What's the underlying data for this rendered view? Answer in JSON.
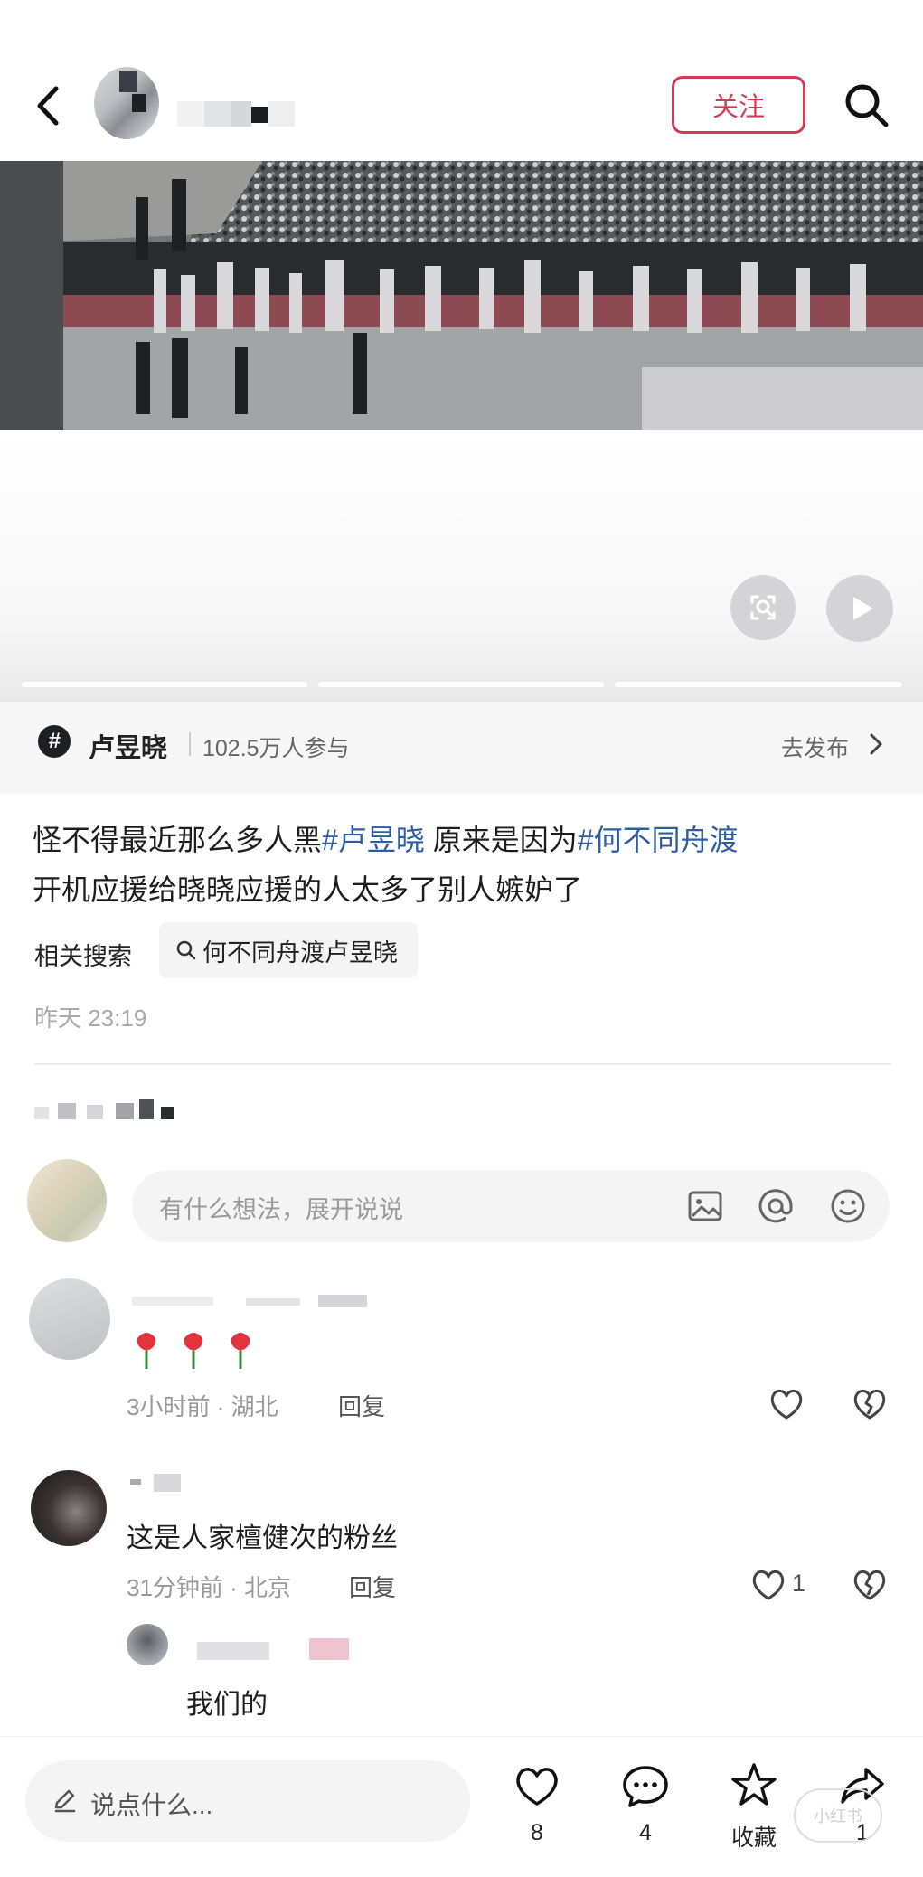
{
  "header": {
    "follow_label": "关注"
  },
  "topic": {
    "name": "卢昱晓",
    "participants": "102.5万人参与",
    "publish_label": "去发布"
  },
  "post": {
    "text_part1": "怪不得最近那么多人黑",
    "tag1": "#卢昱晓",
    "text_part2": " 原来是因为",
    "tag2": "#何不同舟渡",
    "text_part3": "开机应援给晓晓应援的人太多了别人嫉妒了",
    "related_label": "相关搜索",
    "related_query": "何不同舟渡卢昱晓",
    "time": "昨天 23:19"
  },
  "comment_input": {
    "placeholder": "有什么想法，展开说说"
  },
  "comments": [
    {
      "meta": "3小时前 · 湖北",
      "reply_label": "回复",
      "emoji": "🌹🌹🌹"
    },
    {
      "text": "这是人家檀健次的粉丝",
      "meta": "31分钟前 · 北京",
      "reply_label": "回复",
      "likes": "1"
    },
    {
      "text": "我们的"
    }
  ],
  "bottom_bar": {
    "say_placeholder": "说点什么...",
    "like_count": "8",
    "comment_count": "4",
    "collect_label": "收藏",
    "share_count": "1"
  },
  "colors": {
    "accent": "#d33a55",
    "tag": "#2f5ea4",
    "muted": "#999999"
  }
}
